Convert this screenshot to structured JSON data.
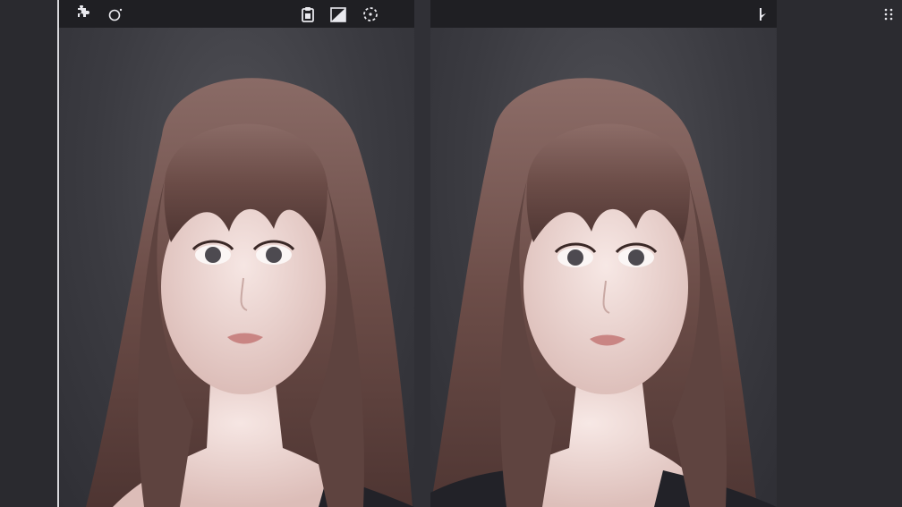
{
  "toolbar": {
    "icons": [
      "puzzle-icon",
      "circle-icon",
      "clipboard-icon",
      "contrast-icon",
      "dashed-circle-icon"
    ],
    "right_icons": [
      "cursor-bar-icon"
    ],
    "far_right_icons": [
      "grid-dots-icon"
    ]
  },
  "colors": {
    "background": "#2c2c31",
    "toolbar": "#1f1f23",
    "hair": "#6e4f4a",
    "skin": "#efd9d6",
    "sweater": "#222228"
  },
  "panels": [
    "left-image-panel",
    "right-image-panel"
  ]
}
